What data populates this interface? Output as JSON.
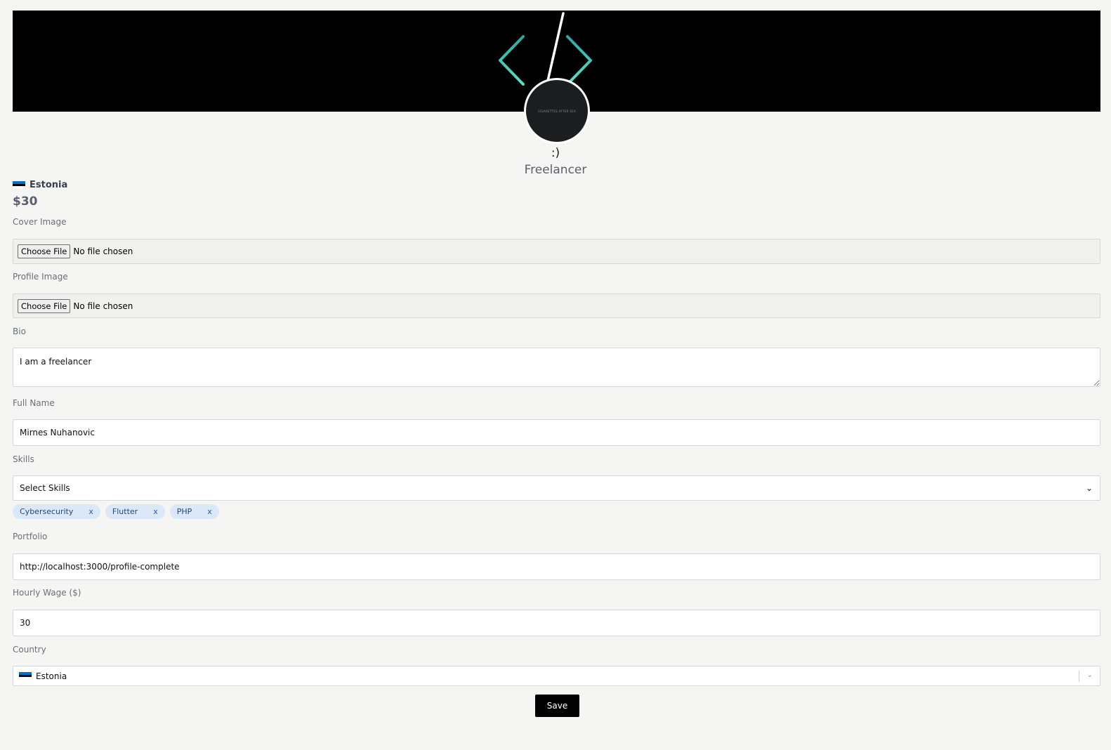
{
  "header": {
    "avatar_text": "CIGARETTES AFTER SEX",
    "nickname": ":)",
    "role": "Freelancer"
  },
  "summary": {
    "country": "Estonia",
    "wage": "$30"
  },
  "form": {
    "cover_image": {
      "label": "Cover Image",
      "button": "Choose File",
      "status": "No file chosen"
    },
    "profile_image": {
      "label": "Profile Image",
      "button": "Choose File",
      "status": "No file chosen"
    },
    "bio": {
      "label": "Bio",
      "value": "I am a freelancer"
    },
    "full_name": {
      "label": "Full Name",
      "value": "Mirnes Nuhanovic"
    },
    "skills": {
      "label": "Skills",
      "placeholder": "Select Skills",
      "selected": [
        {
          "name": "Cybersecurity",
          "remove": "x"
        },
        {
          "name": "Flutter",
          "remove": "x"
        },
        {
          "name": "PHP",
          "remove": "x"
        }
      ]
    },
    "portfolio": {
      "label": "Portfolio",
      "value": "http://localhost:3000/profile-complete"
    },
    "hourly_wage": {
      "label": "Hourly Wage ($)",
      "value": "30"
    },
    "country": {
      "label": "Country",
      "value": "Estonia"
    },
    "save_label": "Save"
  },
  "colors": {
    "cover_bg": "#000000",
    "accent_teal": "#3fc8b4",
    "tag_bg": "#dbe8f8",
    "tag_text": "#24477f",
    "flag_blue": "#0072ce"
  }
}
